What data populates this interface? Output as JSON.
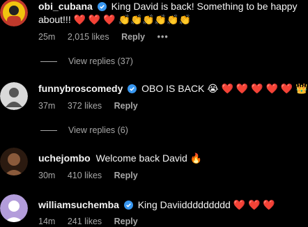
{
  "comments": [
    {
      "username": "obi_cubana",
      "verified": true,
      "text_line1": "King David is back! Something to be happy",
      "text_line2": "about!!! ❤️ ❤️ ❤️ 👏👏👏👏👏👏",
      "time": "25m",
      "likes": "2,015 likes",
      "reply_label": "Reply",
      "more_label": "•••",
      "view_replies": "View replies (37)",
      "avatar_colors": [
        "#c0392b",
        "#f1c40f",
        "#222222"
      ]
    },
    {
      "username": "funnybroscomedy",
      "verified": true,
      "text_line1": "OBO IS BACK 😭 ❤️ ❤️ ❤️ ❤️ ❤️ 👑 🔄",
      "time": "37m",
      "likes": "372 likes",
      "reply_label": "Reply",
      "view_replies": "View replies (6)",
      "avatar_colors": [
        "#d9d9d9",
        "#555555"
      ]
    },
    {
      "username": "uchejombo",
      "verified": false,
      "text_line1": "Welcome back David 🔥",
      "time": "30m",
      "likes": "410 likes",
      "reply_label": "Reply",
      "avatar_colors": [
        "#8a5a3b",
        "#2b1a10"
      ]
    },
    {
      "username": "williamsuchemba",
      "verified": true,
      "text_line1": "King Daviiddddddddd ❤️ ❤️ ❤️",
      "time": "14m",
      "likes": "241 likes",
      "reply_label": "Reply",
      "avatar_colors": [
        "#b39ddb",
        "#ffffff"
      ]
    }
  ],
  "colors": {
    "background": "#000000",
    "text": "#f5f5f5",
    "muted": "#a8a8a8",
    "verified": "#3897f0"
  }
}
